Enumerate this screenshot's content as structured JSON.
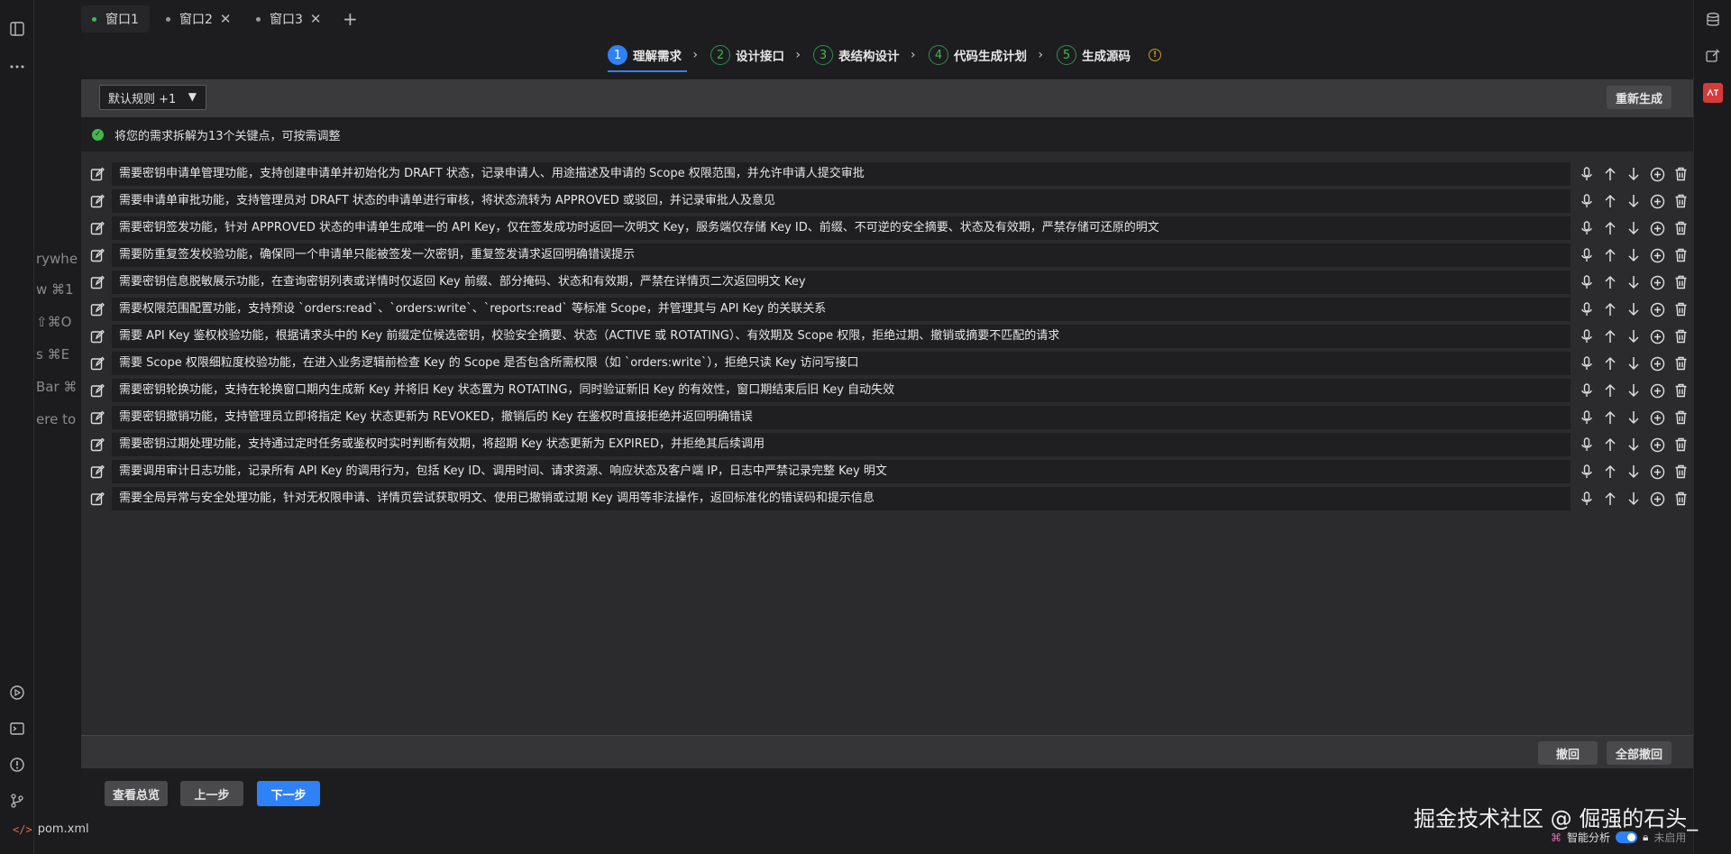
{
  "tabs": [
    {
      "label": "窗口1",
      "active": true
    },
    {
      "label": "窗口2",
      "active": false
    },
    {
      "label": "窗口3",
      "active": false
    }
  ],
  "tab_close_glyph": "✕",
  "tab_add_glyph": "+",
  "steps": [
    {
      "num": "1",
      "label": "理解需求",
      "active": true
    },
    {
      "num": "2",
      "label": "设计接口",
      "active": false
    },
    {
      "num": "3",
      "label": "表结构设计",
      "active": false
    },
    {
      "num": "4",
      "label": "代码生成计划",
      "active": false
    },
    {
      "num": "5",
      "label": "生成源码",
      "active": false
    }
  ],
  "toolbar": {
    "rule_select": "默认规则 +1",
    "regenerate": "重新生成"
  },
  "summary": "将您的需求拆解为13个关键点，可按需调整",
  "requirements": [
    "需要密钥申请单管理功能，支持创建申请单并初始化为 DRAFT 状态，记录申请人、用途描述及申请的 Scope 权限范围，并允许申请人提交审批",
    "需要申请单审批功能，支持管理员对 DRAFT 状态的申请单进行审核，将状态流转为 APPROVED 或驳回，并记录审批人及意见",
    "需要密钥签发功能，针对 APPROVED 状态的申请单生成唯一的 API Key，仅在签发成功时返回一次明文 Key，服务端仅存储 Key ID、前缀、不可逆的安全摘要、状态及有效期，严禁存储可还原的明文",
    "需要防重复签发校验功能，确保同一个申请单只能被签发一次密钥，重复签发请求返回明确错误提示",
    "需要密钥信息脱敏展示功能，在查询密钥列表或详情时仅返回 Key 前缀、部分掩码、状态和有效期，严禁在详情页二次返回明文 Key",
    "需要权限范围配置功能，支持预设 `orders:read`、`orders:write`、`reports:read` 等标准 Scope，并管理其与 API Key 的关联关系",
    "需要 API Key 鉴权校验功能，根据请求头中的 Key 前缀定位候选密钥，校验安全摘要、状态（ACTIVE 或 ROTATING）、有效期及 Scope 权限，拒绝过期、撤销或摘要不匹配的请求",
    "需要 Scope 权限细粒度校验功能，在进入业务逻辑前检查 Key 的 Scope 是否包含所需权限（如 `orders:write`），拒绝只读 Key 访问写接口",
    "需要密钥轮换功能，支持在轮换窗口期内生成新 Key 并将旧 Key 状态置为 ROTATING，同时验证新旧 Key 的有效性，窗口期结束后旧 Key 自动失效",
    "需要密钥撤销功能，支持管理员立即将指定 Key 状态更新为 REVOKED，撤销后的 Key 在鉴权时直接拒绝并返回明确错误",
    "需要密钥过期处理功能，支持通过定时任务或鉴权时实时判断有效期，将超期 Key 状态更新为 EXPIRED，并拒绝其后续调用",
    "需要调用审计日志功能，记录所有 API Key 的调用行为，包括 Key ID、调用时间、请求资源、响应状态及客户端 IP，日志中严禁记录完整 Key 明文",
    "需要全局异常与安全处理功能，针对无权限申请、详情页尝试获取明文、使用已撤销或过期 Key 调用等非法操作，返回标准化的错误码和提示信息"
  ],
  "bottom_bar": {
    "undo": "撤回",
    "undo_all": "全部撤回"
  },
  "footer": {
    "overview": "查看总览",
    "prev": "上一步",
    "next": "下一步"
  },
  "status": {
    "file": "pom.xml",
    "smart_analysis": "智能分析",
    "disabled": "未启用"
  },
  "ghost_text": [
    "rywhe",
    "w  ⌘1",
    "⇧⌘O",
    "s  ⌘E",
    "Bar  ⌘",
    "ere to"
  ],
  "watermark": "掘金技术社区 @ 倔强的石头_",
  "colors": {
    "accent": "#2f81f7",
    "success": "#3fb950",
    "warning": "#d29922"
  }
}
